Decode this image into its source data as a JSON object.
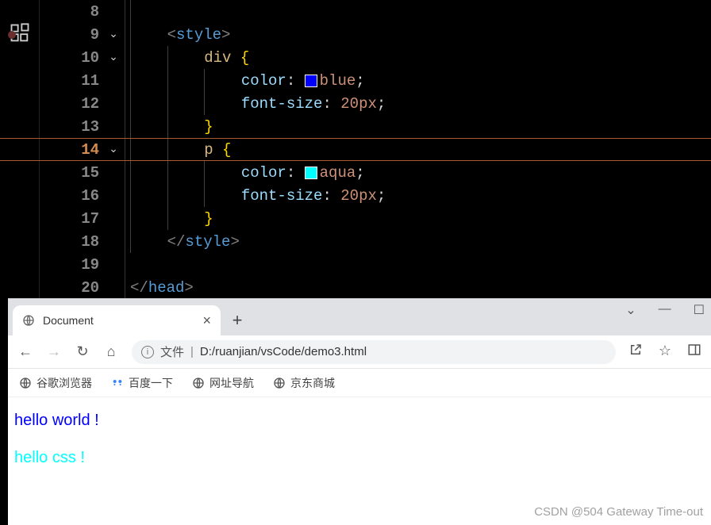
{
  "editor": {
    "lines": [
      {
        "num": "8",
        "fold": "",
        "indent": 1,
        "tokens": []
      },
      {
        "num": "9",
        "fold": "⌄",
        "bp": true,
        "indent": 1,
        "tokens": [
          [
            "punct",
            "<"
          ],
          [
            "tag",
            "style"
          ],
          [
            "punct",
            ">"
          ]
        ]
      },
      {
        "num": "10",
        "fold": "⌄",
        "indent": 2,
        "tokens": [
          [
            "sel",
            "div "
          ],
          [
            "brace",
            "{"
          ]
        ]
      },
      {
        "num": "11",
        "fold": "",
        "indent": 3,
        "tokens": [
          [
            "prop",
            "color"
          ],
          [
            "colon",
            ": "
          ],
          [
            "swatch",
            "blue"
          ],
          [
            "val",
            "blue"
          ],
          [
            "semi",
            ";"
          ]
        ]
      },
      {
        "num": "12",
        "fold": "",
        "indent": 3,
        "tokens": [
          [
            "prop",
            "font-size"
          ],
          [
            "colon",
            ": "
          ],
          [
            "val",
            "20px"
          ],
          [
            "semi",
            ";"
          ]
        ]
      },
      {
        "num": "13",
        "fold": "",
        "indent": 2,
        "tokens": [
          [
            "brace",
            "}"
          ]
        ]
      },
      {
        "num": "14",
        "fold": "⌄",
        "current": true,
        "indent": 2,
        "tokens": [
          [
            "sel",
            "p "
          ],
          [
            "brace",
            "{"
          ]
        ]
      },
      {
        "num": "15",
        "fold": "",
        "indent": 3,
        "tokens": [
          [
            "prop",
            "color"
          ],
          [
            "colon",
            ": "
          ],
          [
            "swatch",
            "aqua"
          ],
          [
            "val",
            "aqua"
          ],
          [
            "semi",
            ";"
          ]
        ]
      },
      {
        "num": "16",
        "fold": "",
        "indent": 3,
        "tokens": [
          [
            "prop",
            "font-size"
          ],
          [
            "colon",
            ": "
          ],
          [
            "val",
            "20px"
          ],
          [
            "semi",
            ";"
          ]
        ]
      },
      {
        "num": "17",
        "fold": "",
        "indent": 2,
        "tokens": [
          [
            "brace",
            "}"
          ]
        ]
      },
      {
        "num": "18",
        "fold": "",
        "indent": 1,
        "tokens": [
          [
            "punct",
            "</"
          ],
          [
            "tag",
            "style"
          ],
          [
            "punct",
            ">"
          ]
        ]
      },
      {
        "num": "19",
        "fold": "",
        "indent": 0,
        "tokens": []
      },
      {
        "num": "20",
        "fold": "",
        "indent": 0,
        "tokens": [
          [
            "punct",
            "</"
          ],
          [
            "tag",
            "head"
          ],
          [
            "punct",
            ">"
          ]
        ]
      }
    ]
  },
  "browser": {
    "tab_title": "Document",
    "url_kind": "文件",
    "url_sep": "|",
    "url_path": "D:/ruanjian/vsCode/demo3.html",
    "bookmarks": [
      "谷歌浏览器",
      "百度一下",
      "网址导航",
      "京东商城"
    ],
    "page": {
      "div_text": "hello world !",
      "p_text": "hello css !"
    }
  },
  "watermark": "CSDN @504 Gateway Time-out"
}
